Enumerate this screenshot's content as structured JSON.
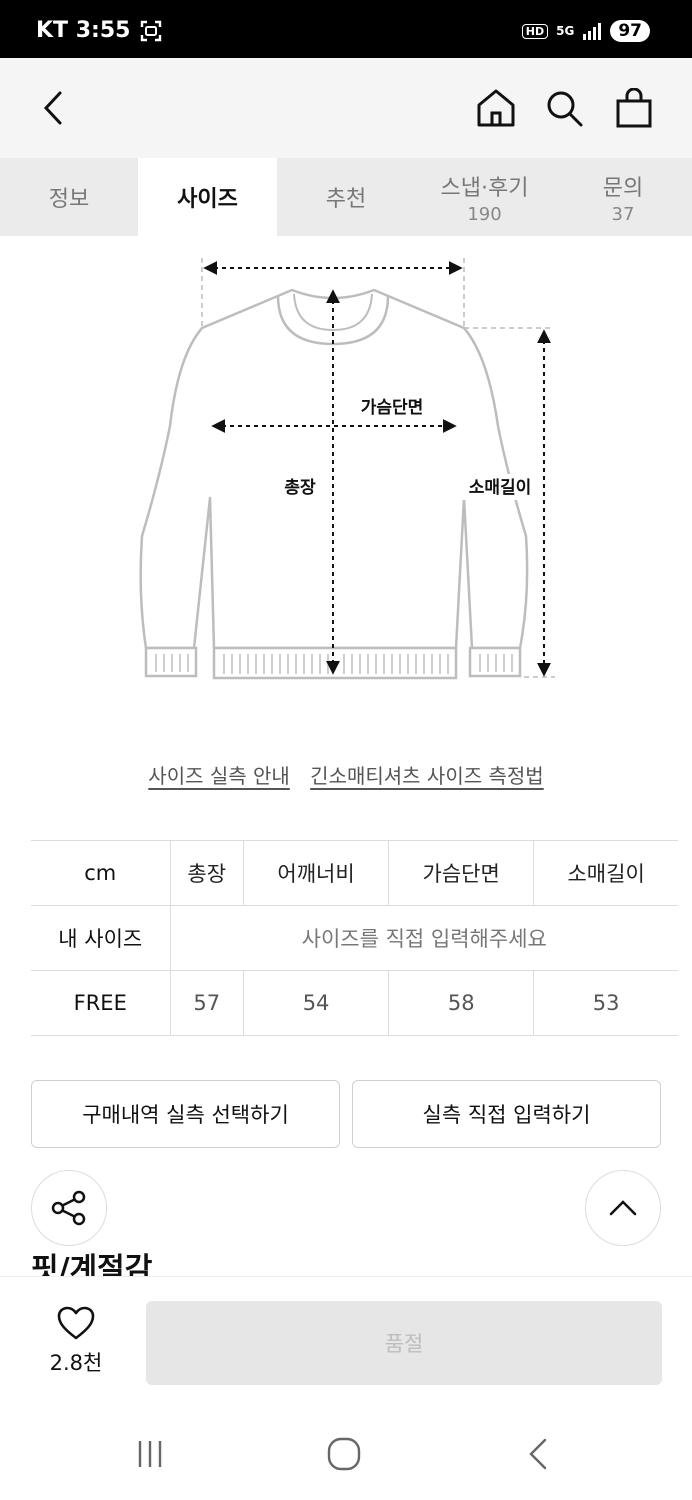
{
  "status": {
    "carrier_time": "KT 3:55",
    "hd": "HD",
    "network": "5G",
    "battery": "97"
  },
  "tabs": [
    {
      "label": "정보",
      "count": ""
    },
    {
      "label": "사이즈",
      "count": ""
    },
    {
      "label": "추천",
      "count": ""
    },
    {
      "label": "스냅·후기",
      "count": "190"
    },
    {
      "label": "문의",
      "count": "37"
    }
  ],
  "diagram": {
    "chest_label": "가슴단면",
    "length_label": "총장",
    "sleeve_label": "소매길이"
  },
  "links": {
    "size_guide": "사이즈 실측 안내",
    "measure_method": "긴소매티셔츠 사이즈 측정법"
  },
  "size_table": {
    "headers": [
      "cm",
      "총장",
      "어깨너비",
      "가슴단면",
      "소매길이"
    ],
    "my_size_label": "내 사이즈",
    "my_size_placeholder": "사이즈를 직접 입력해주세요",
    "rows": [
      {
        "size": "FREE",
        "values": [
          "57",
          "54",
          "58",
          "53"
        ]
      }
    ]
  },
  "actions": {
    "purchase_history": "구매내역 실측 선택하기",
    "manual_input": "실측 직접 입력하기"
  },
  "section": {
    "title": "핏/계절감"
  },
  "bottom": {
    "like_count": "2.8천",
    "buy_label": "품절"
  }
}
